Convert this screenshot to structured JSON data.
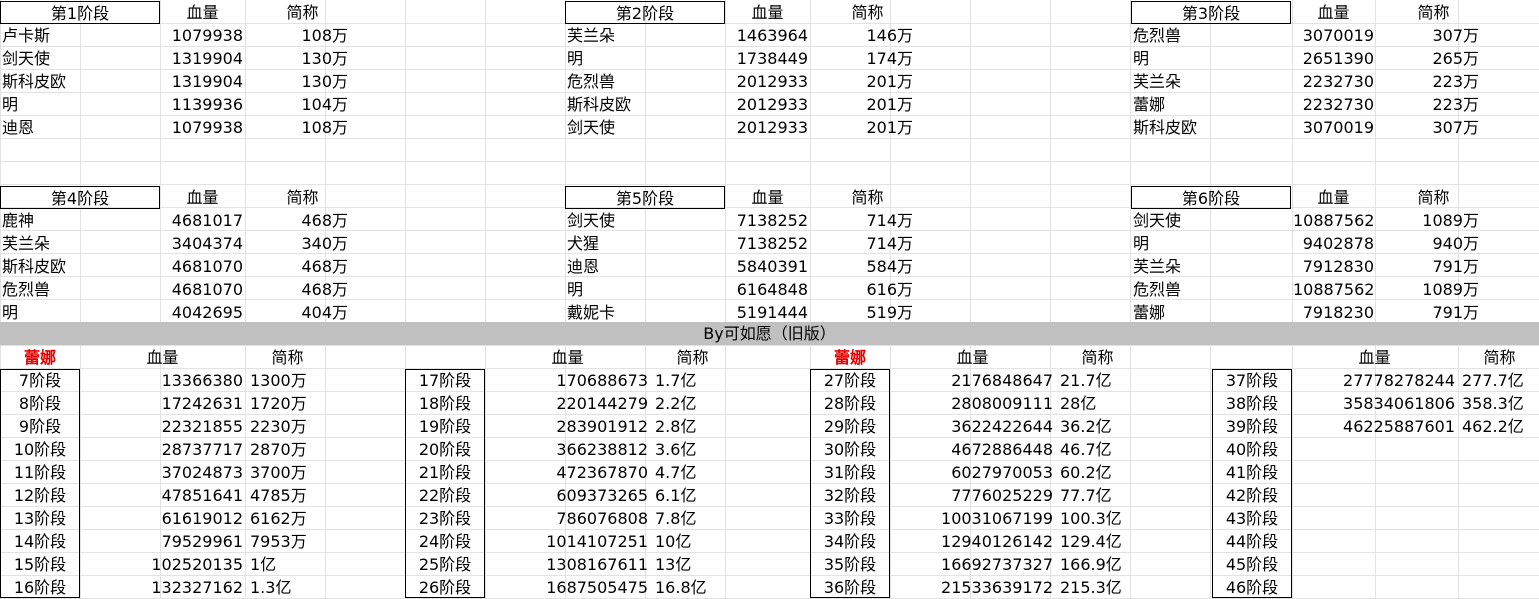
{
  "sheet": {
    "top_groups": [
      {
        "stage": "第1阶段",
        "hp_header": "血量",
        "abbr_header": "简称",
        "rows": [
          [
            "卢卡斯",
            "1079938",
            "108万"
          ],
          [
            "剑天使",
            "1319904",
            "130万"
          ],
          [
            "斯科皮欧",
            "1319904",
            "130万"
          ],
          [
            "明",
            "1139936",
            "104万"
          ],
          [
            "迪恩",
            "1079938",
            "108万"
          ]
        ]
      },
      {
        "stage": "第2阶段",
        "hp_header": "血量",
        "abbr_header": "简称",
        "rows": [
          [
            "芙兰朵",
            "1463964",
            "146万"
          ],
          [
            "明",
            "1738449",
            "174万"
          ],
          [
            "危烈兽",
            "2012933",
            "201万"
          ],
          [
            "斯科皮欧",
            "2012933",
            "201万"
          ],
          [
            "剑天使",
            "2012933",
            "201万"
          ]
        ]
      },
      {
        "stage": "第3阶段",
        "hp_header": "血量",
        "abbr_header": "简称",
        "rows": [
          [
            "危烈兽",
            "3070019",
            "307万"
          ],
          [
            "明",
            "2651390",
            "265万"
          ],
          [
            "芙兰朵",
            "2232730",
            "223万"
          ],
          [
            "蕾娜",
            "2232730",
            "223万"
          ],
          [
            "斯科皮欧",
            "3070019",
            "307万"
          ]
        ]
      },
      {
        "stage": "第4阶段",
        "hp_header": "血量",
        "abbr_header": "简称",
        "rows": [
          [
            "鹿神",
            "4681017",
            "468万"
          ],
          [
            "芙兰朵",
            "3404374",
            "340万"
          ],
          [
            "斯科皮欧",
            "4681070",
            "468万"
          ],
          [
            "危烈兽",
            "4681070",
            "468万"
          ],
          [
            "明",
            "4042695",
            "404万"
          ]
        ]
      },
      {
        "stage": "第5阶段",
        "hp_header": "血量",
        "abbr_header": "简称",
        "rows": [
          [
            "剑天使",
            "7138252",
            "714万"
          ],
          [
            "犬猩",
            "7138252",
            "714万"
          ],
          [
            "迪恩",
            "5840391",
            "584万"
          ],
          [
            "明",
            "6164848",
            "616万"
          ],
          [
            "戴妮卡",
            "5191444",
            "519万"
          ]
        ]
      },
      {
        "stage": "第6阶段",
        "hp_header": "血量",
        "abbr_header": "简称",
        "rows": [
          [
            "剑天使",
            "10887562",
            "1089万"
          ],
          [
            "明",
            "9402878",
            "940万"
          ],
          [
            "芙兰朵",
            "7912830",
            "791万"
          ],
          [
            "危烈兽",
            "10887562",
            "1089万"
          ],
          [
            "蕾娜",
            "7918230",
            "791万"
          ]
        ]
      }
    ],
    "banner": "By可如愿（旧版）",
    "bottom_groups": [
      {
        "title": "蕾娜",
        "hp_header": "血量",
        "abbr_header": "简称",
        "rows": [
          [
            "7阶段",
            "13366380",
            "1300万"
          ],
          [
            "8阶段",
            "17242631",
            "1720万"
          ],
          [
            "9阶段",
            "22321855",
            "2230万"
          ],
          [
            "10阶段",
            "28737717",
            "2870万"
          ],
          [
            "11阶段",
            "37024873",
            "3700万"
          ],
          [
            "12阶段",
            "47851641",
            "4785万"
          ],
          [
            "13阶段",
            "61619012",
            "6162万"
          ],
          [
            "14阶段",
            "79529961",
            "7953万"
          ],
          [
            "15阶段",
            "102520135",
            "1亿"
          ],
          [
            "16阶段",
            "132327162",
            "1.3亿"
          ]
        ]
      },
      {
        "title": "",
        "hp_header": "血量",
        "abbr_header": "简称",
        "rows": [
          [
            "17阶段",
            "170688673",
            "1.7亿"
          ],
          [
            "18阶段",
            "220144279",
            "2.2亿"
          ],
          [
            "19阶段",
            "283901912",
            "2.8亿"
          ],
          [
            "20阶段",
            "366238812",
            "3.6亿"
          ],
          [
            "21阶段",
            "472367870",
            "4.7亿"
          ],
          [
            "22阶段",
            "609373265",
            "6.1亿"
          ],
          [
            "23阶段",
            "786076808",
            "7.8亿"
          ],
          [
            "24阶段",
            "1014107251",
            "10亿"
          ],
          [
            "25阶段",
            "1308167611",
            "13亿"
          ],
          [
            "26阶段",
            "1687505475",
            "16.8亿"
          ]
        ]
      },
      {
        "title": "蕾娜",
        "hp_header": "血量",
        "abbr_header": "简称",
        "rows": [
          [
            "27阶段",
            "2176848647",
            "21.7亿"
          ],
          [
            "28阶段",
            "2808009111",
            "28亿"
          ],
          [
            "29阶段",
            "3622422644",
            "36.2亿"
          ],
          [
            "30阶段",
            "4672886448",
            "46.7亿"
          ],
          [
            "31阶段",
            "6027970053",
            "60.2亿"
          ],
          [
            "32阶段",
            "7776025229",
            "77.7亿"
          ],
          [
            "33阶段",
            "10031067199",
            "100.3亿"
          ],
          [
            "34阶段",
            "12940126142",
            "129.4亿"
          ],
          [
            "35阶段",
            "16692737327",
            "166.9亿"
          ],
          [
            "36阶段",
            "21533639172",
            "215.3亿"
          ]
        ]
      },
      {
        "title": "",
        "hp_header": "血量",
        "abbr_header": "简称",
        "rows": [
          [
            "37阶段",
            "27778278244",
            "277.7亿"
          ],
          [
            "38阶段",
            "35834061806",
            "358.3亿"
          ],
          [
            "39阶段",
            "46225887601",
            "462.2亿"
          ],
          [
            "40阶段",
            "",
            ""
          ],
          [
            "41阶段",
            "",
            ""
          ],
          [
            "42阶段",
            "",
            ""
          ],
          [
            "43阶段",
            "",
            ""
          ],
          [
            "44阶段",
            "",
            ""
          ],
          [
            "45阶段",
            "",
            ""
          ],
          [
            "46阶段",
            "",
            ""
          ]
        ]
      }
    ]
  }
}
